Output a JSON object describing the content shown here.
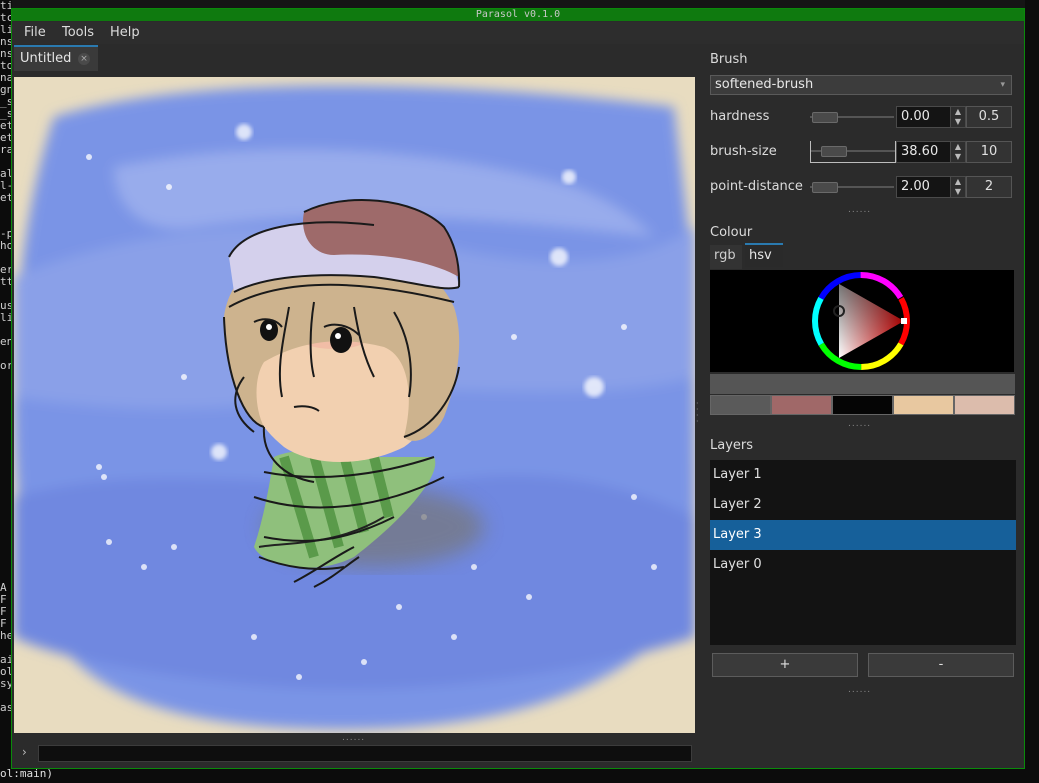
{
  "terminal": {
    "left_fragments": [
      "ti",
      "tc",
      "li",
      "ns",
      "ns",
      "to",
      "na",
      "gn",
      "_s",
      "_s",
      "et",
      "et",
      "ra",
      "",
      "al",
      "l-",
      "et",
      "",
      "",
      "-p",
      "ho",
      "",
      "er",
      "tt",
      "",
      "us",
      "li",
      "",
      "en",
      "",
      "or"
    ],
    "left_fragments_bottom": [
      "A",
      "F",
      "F",
      "F",
      "he",
      "",
      "ai",
      "ol",
      "sy",
      "",
      "as"
    ],
    "bottom_line": "ol:main)"
  },
  "window": {
    "title": "Parasol v0.1.0"
  },
  "menu": [
    "File",
    "Tools",
    "Help"
  ],
  "document_tab": {
    "label": "Untitled",
    "close": "×"
  },
  "command": {
    "prompt": "›"
  },
  "brush": {
    "title": "Brush",
    "selected": "softened-brush",
    "rows": [
      {
        "name": "hardness",
        "value": "0.00",
        "preset": "0.5",
        "fraction": 0.0
      },
      {
        "name": "brush-size",
        "value": "38.60",
        "preset": "10",
        "fraction": 0.1
      },
      {
        "name": "point-distance",
        "value": "2.00",
        "preset": "2",
        "fraction": 0.0
      }
    ]
  },
  "colour": {
    "title": "Colour",
    "tabs": [
      "rgb",
      "hsv"
    ],
    "active_tab": "hsv",
    "swatches": [
      "#5a5a5a",
      "#a06868",
      "#050505",
      "#e8c8a0",
      "#dcbcac"
    ]
  },
  "layers": {
    "title": "Layers",
    "items": [
      "Layer 1",
      "Layer 2",
      "Layer 3",
      "Layer 0"
    ],
    "selected": "Layer 3",
    "add_label": "+",
    "remove_label": "-"
  },
  "grip": "......"
}
